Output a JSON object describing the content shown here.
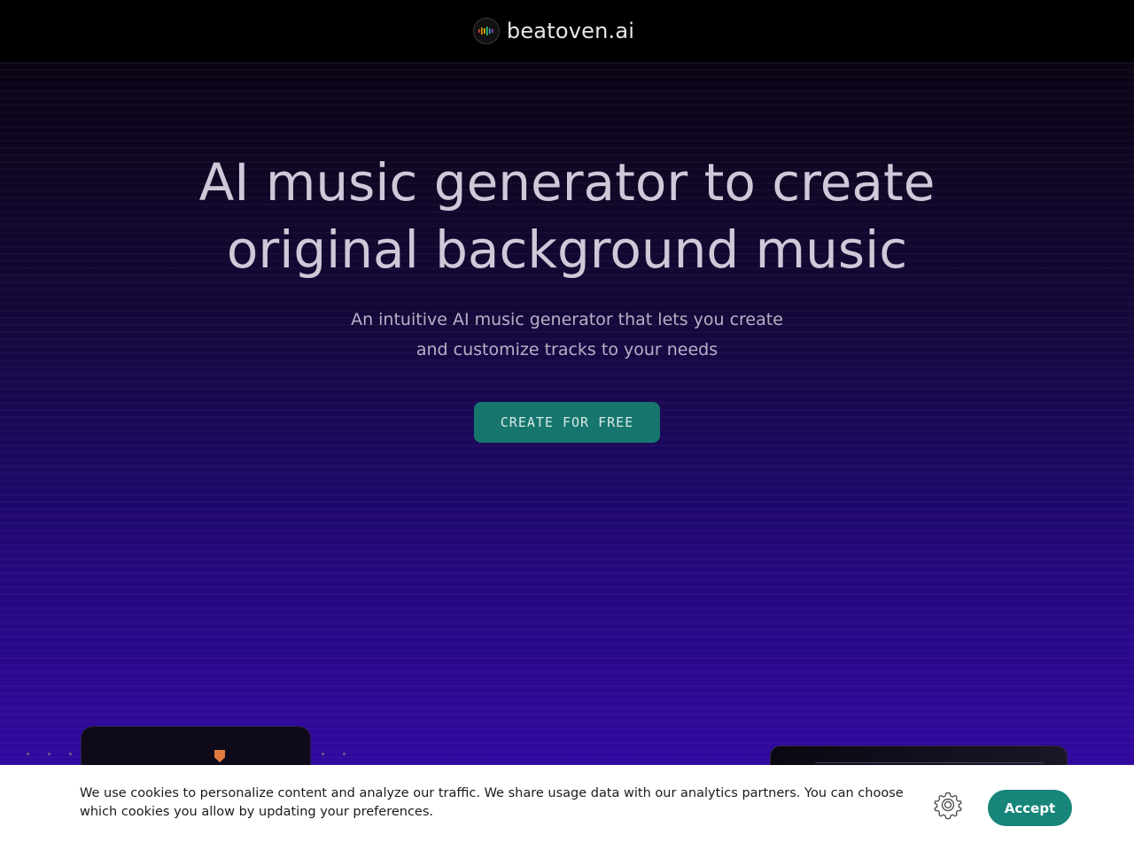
{
  "header": {
    "brand_name": "beatoven.ai",
    "logo_icon": "equalizer-logo-icon"
  },
  "hero": {
    "headline": "AI music generator to create original background music",
    "subhead_line1": "An intuitive AI music generator that lets you create",
    "subhead_line2": "and customize tracks to your needs",
    "cta_label": "CREATE FOR FREE"
  },
  "cookie_banner": {
    "text": "We use cookies to personalize content and analyze our traffic. We share usage data with our analytics partners. You can choose which cookies you allow by updating your preferences.",
    "settings_icon": "gear-icon",
    "accept_label": "Accept"
  },
  "colors": {
    "cta": "#16766d",
    "accept": "#17857a",
    "hero_top": "#0b0414",
    "hero_bottom": "#3209a0"
  }
}
